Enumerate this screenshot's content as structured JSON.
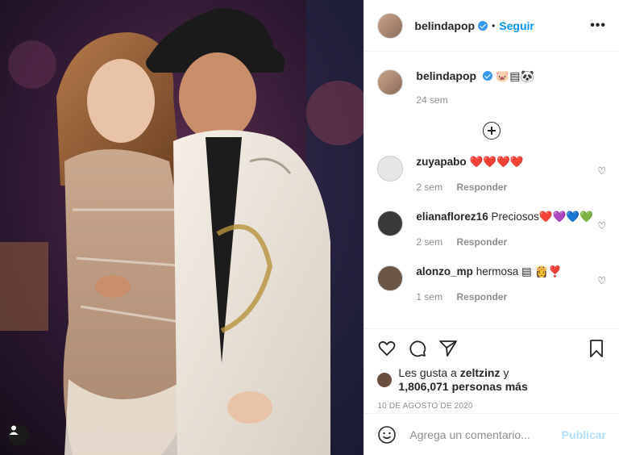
{
  "post": {
    "username": "belindapop",
    "follow_label": "Seguir",
    "separator": "•",
    "more_label": "•••"
  },
  "caption": {
    "username": "belindapop",
    "text": "🐷▤🐼",
    "time": "24 sem"
  },
  "comments": [
    {
      "username": "zuyapabo",
      "text": "❤️❤️❤️❤️",
      "time": "2 sem",
      "reply": "Responder"
    },
    {
      "username": "elianaflorez16",
      "text": "Preciosos❤️💜💙💚",
      "time": "2 sem",
      "reply": "Responder"
    },
    {
      "username": "alonzo_mp",
      "text": "hermosa ▤ 👸❣️",
      "time": "1 sem",
      "reply": "Responder"
    }
  ],
  "likes": {
    "prefix": "Les gusta a",
    "user": "zeltzinz",
    "suffix": "y",
    "count_text": "1,806,071 personas más"
  },
  "date": "10 DE AGOSTO DE 2020",
  "add_comment": {
    "placeholder": "Agrega un comentario...",
    "publish_label": "Publicar"
  },
  "icons": {
    "like": "heart-icon",
    "comment": "comment-icon",
    "share": "paper-plane-icon",
    "save": "bookmark-icon",
    "emoji": "emoji-icon",
    "tags": "person-tag-icon"
  },
  "colors": {
    "accent": "#0095f6",
    "verified": "#3897f0",
    "muted": "#8e8e8e",
    "publish_disabled": "#b2dffc"
  }
}
